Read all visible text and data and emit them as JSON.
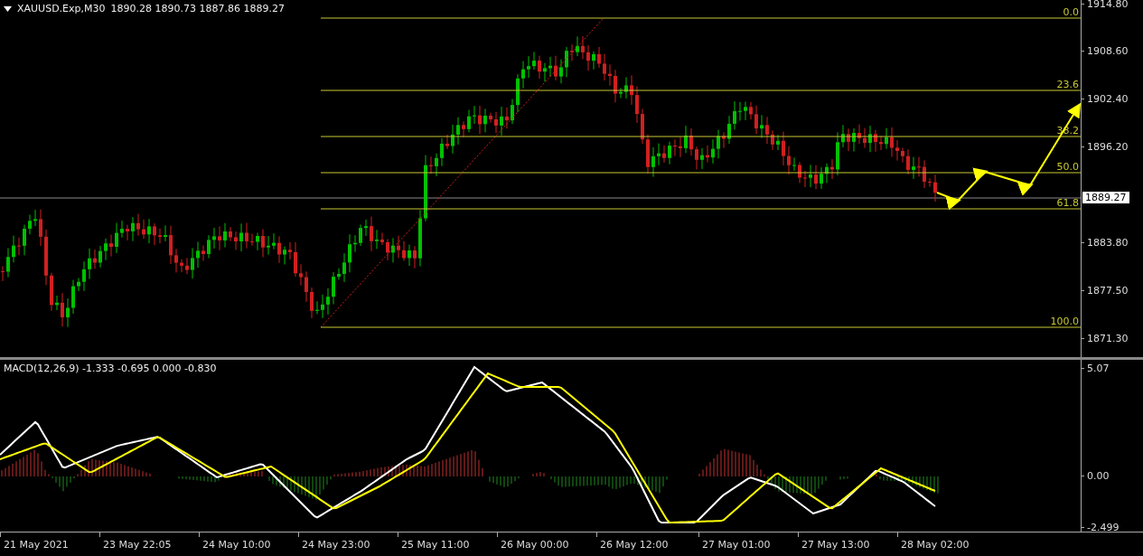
{
  "chart_header": {
    "symbol": "XAUUSD.Exp,M30",
    "values": "1890.28 1890.73 1887.86 1889.27"
  },
  "fibonacci_levels": [
    {
      "label": "0.0"
    },
    {
      "label": "23.6"
    },
    {
      "label": "38.2"
    },
    {
      "label": "50.0"
    },
    {
      "label": "61.8"
    },
    {
      "label": "100.0"
    }
  ],
  "price_axis": [
    "1914.80",
    "1908.60",
    "1902.40",
    "1896.20",
    "1883.80",
    "1877.50",
    "1871.30"
  ],
  "current_price": "1889.27",
  "macd_header": "MACD(12,26,9) -1.333 -0.695 0.000 -0.830",
  "macd_axis": [
    "5.07",
    "0.00",
    "-2.499"
  ],
  "time_axis": [
    "21 May 2021",
    "23 May 22:05",
    "24 May 10:00",
    "24 May 23:00",
    "25 May 11:00",
    "26 May 00:00",
    "26 May 12:00",
    "27 May 01:00",
    "27 May 13:00",
    "28 May 02:00"
  ]
}
